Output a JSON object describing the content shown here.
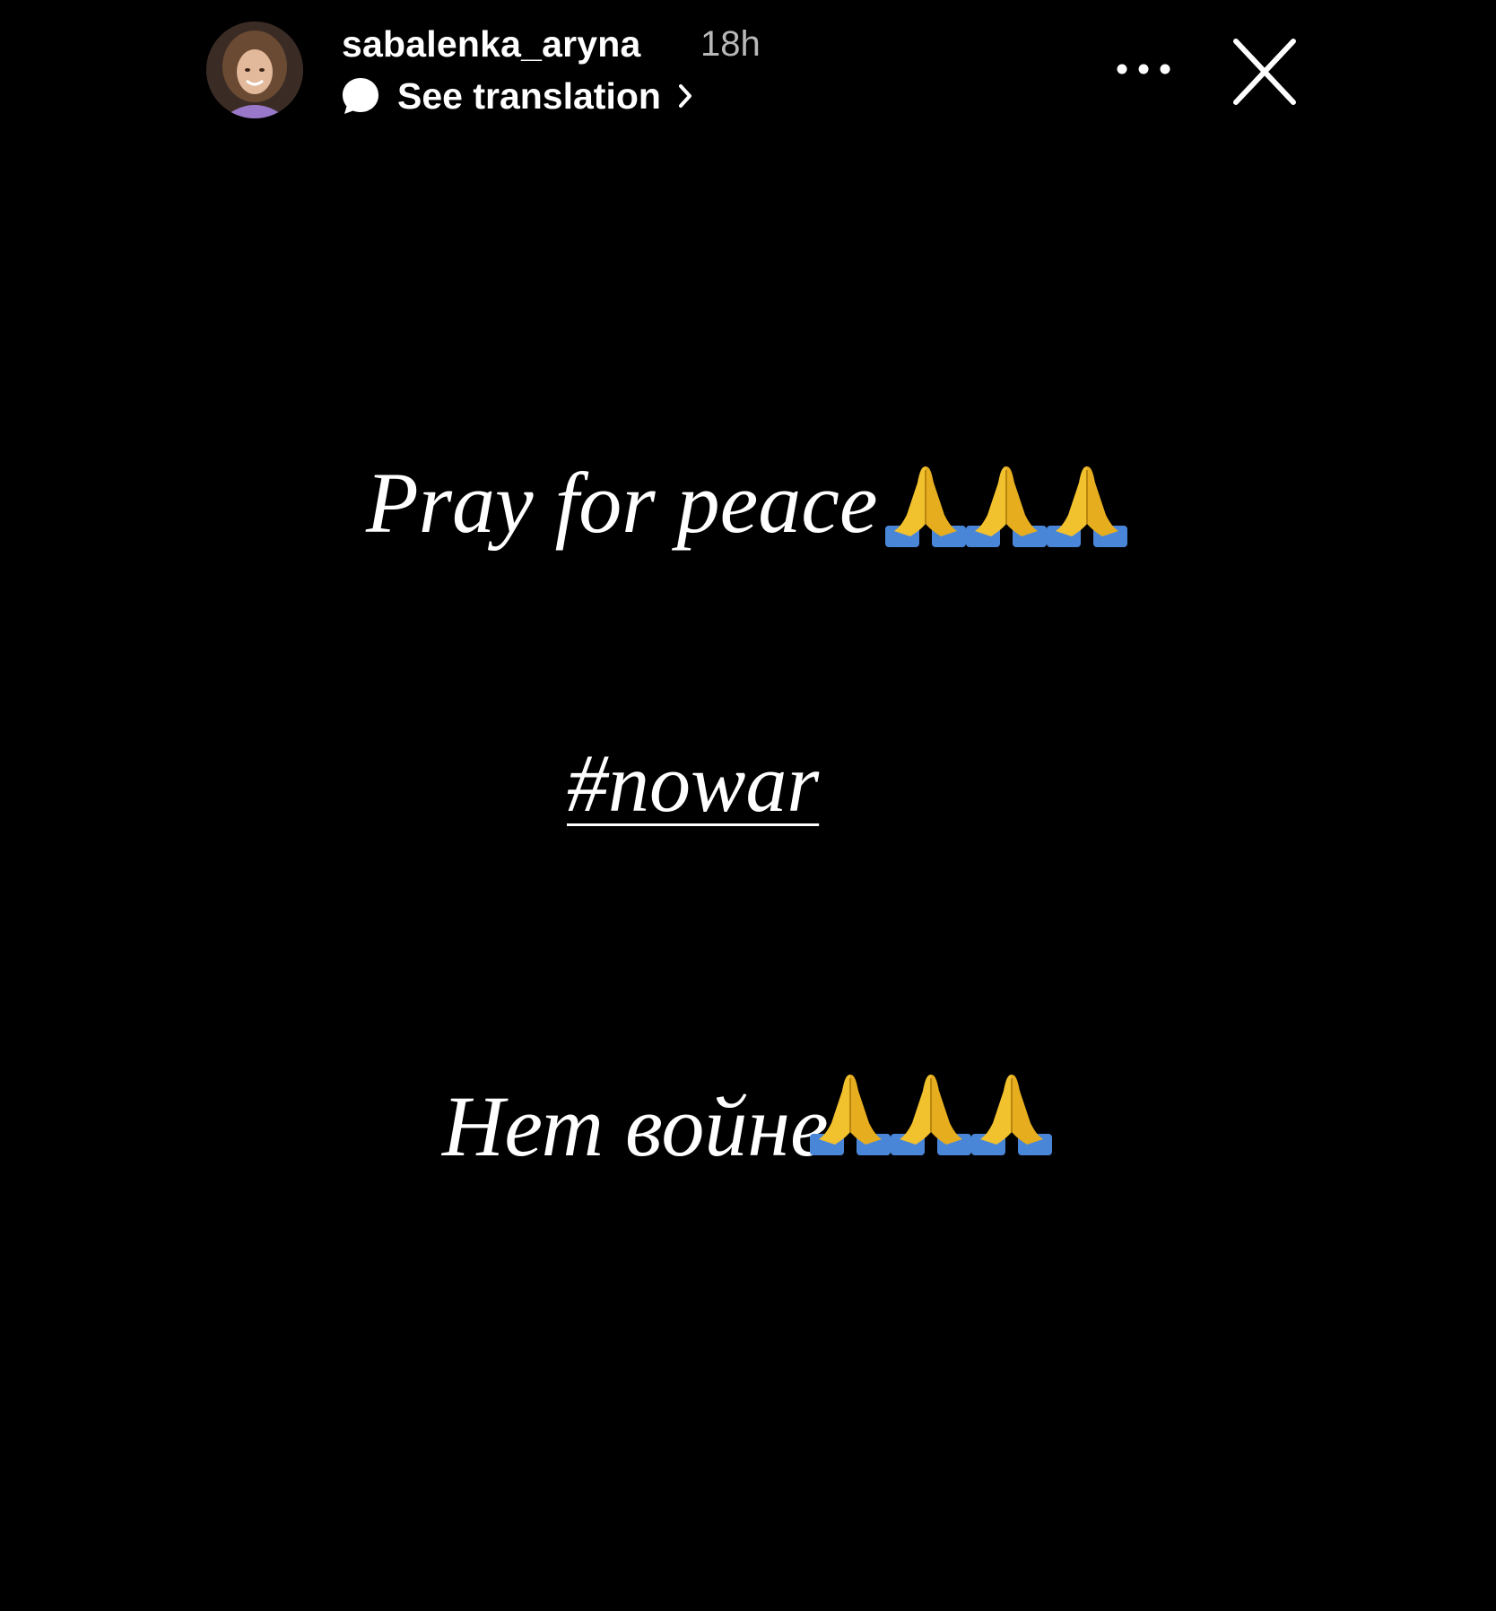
{
  "header": {
    "username": "sabalenka_aryna",
    "timestamp": "18h",
    "translate_label": "See translation",
    "icons": {
      "avatar": "profile-photo",
      "bubble": "speech-bubble-icon",
      "chevron": "chevron-right-icon",
      "more": "more-dots-icon",
      "close": "close-icon"
    }
  },
  "story": {
    "line1": "Pray for peace",
    "line2": "#nowar",
    "line3": "Нет войне",
    "emoji": "folded-hands",
    "emoji_count_line1": 3,
    "emoji_count_line3": 3
  },
  "colors": {
    "background": "#000000",
    "text": "#ffffff",
    "timestamp": "#b8b8b8",
    "hands_yellow": "#f2c12e",
    "sleeve_blue": "#4a86d8"
  }
}
